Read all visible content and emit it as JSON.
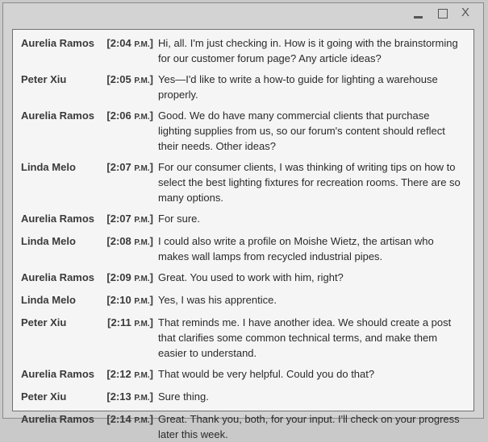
{
  "window": {
    "controls": {
      "minimize": "minimize",
      "maximize": "maximize",
      "close": "X"
    }
  },
  "messages": [
    {
      "name": "Aurelia Ramos",
      "time": "[2:04 ",
      "ampm": "P.M.",
      "close": "]",
      "text": "Hi, all. I'm just checking in. How is it going with the brainstorming for our customer forum page? Any article ideas?"
    },
    {
      "name": "Peter Xiu",
      "time": "[2:05 ",
      "ampm": "P.M.",
      "close": "]",
      "text": "Yes—I'd like to write a how-to guide for lighting a warehouse properly."
    },
    {
      "name": "Aurelia Ramos",
      "time": "[2:06 ",
      "ampm": "P.M.",
      "close": "]",
      "text": "Good. We do have many commercial clients that purchase lighting supplies from us, so our forum's content should reflect their needs. Other ideas?"
    },
    {
      "name": "Linda Melo",
      "time": "[2:07 ",
      "ampm": "P.M.",
      "close": "]",
      "text": "For our consumer clients, I was thinking of writing tips on how to select the best lighting fixtures for recreation rooms. There are so many options."
    },
    {
      "name": "Aurelia Ramos",
      "time": "[2:07 ",
      "ampm": "P.M.",
      "close": "]",
      "text": "For sure."
    },
    {
      "name": "Linda Melo",
      "time": "[2:08 ",
      "ampm": "P.M.",
      "close": "]",
      "text": "I could also write a profile on Moishe Wietz, the artisan who makes wall lamps from recycled industrial pipes."
    },
    {
      "name": "Aurelia Ramos",
      "time": "[2:09 ",
      "ampm": "P.M.",
      "close": "]",
      "text": "Great. You used to work with him, right?"
    },
    {
      "name": "Linda Melo",
      "time": "[2:10 ",
      "ampm": "P.M.",
      "close": "]",
      "text": "Yes, I was his apprentice."
    },
    {
      "name": "Peter Xiu",
      "time": "[2:11 ",
      "ampm": "P.M.",
      "close": "]",
      "text": "That reminds me. I have another idea. We should create a post that clarifies some common technical terms, and make them easier to understand."
    },
    {
      "name": "Aurelia Ramos",
      "time": "[2:12 ",
      "ampm": "P.M.",
      "close": "]",
      "text": "That would be very helpful. Could you do that?"
    },
    {
      "name": "Peter Xiu",
      "time": "[2:13 ",
      "ampm": "P.M.",
      "close": "]",
      "text": "Sure thing."
    },
    {
      "name": "Aurelia Ramos",
      "time": "[2:14 ",
      "ampm": "P.M.",
      "close": "]",
      "text": "Great. Thank you, both, for your input. I'll check on your progress later this week."
    }
  ]
}
